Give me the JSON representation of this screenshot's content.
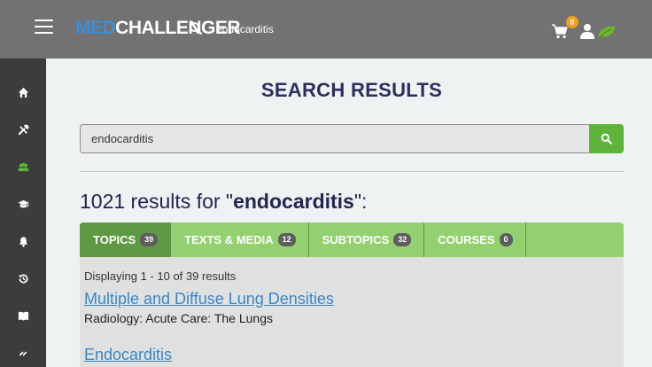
{
  "header": {
    "logo_med": "MED",
    "logo_challenger": "CHALLENGER",
    "search_query": "endocarditis",
    "cart_count": "0"
  },
  "sidebar": {
    "items": [
      {
        "icon": "home-icon"
      },
      {
        "icon": "tools-icon"
      },
      {
        "icon": "users-icon",
        "active": true
      },
      {
        "icon": "graduation-cap-icon"
      },
      {
        "icon": "bell-icon"
      },
      {
        "icon": "history-icon"
      },
      {
        "icon": "book-icon"
      },
      {
        "icon": "more-icon"
      }
    ]
  },
  "main": {
    "title": "SEARCH RESULTS",
    "search_value": "endocarditis",
    "results_count": "1021",
    "results_mid": " results for \"",
    "results_query": "endocarditis",
    "results_end": "\":",
    "tabs": [
      {
        "label": "TOPICS",
        "count": "39",
        "active": true
      },
      {
        "label": "TEXTS & MEDIA",
        "count": "12"
      },
      {
        "label": "SUBTOPICS",
        "count": "32"
      },
      {
        "label": "COURSES",
        "count": "0"
      }
    ],
    "displaying": "Displaying 1 - 10 of 39 results",
    "results": [
      {
        "title": "Multiple and Diffuse Lung Densities",
        "subtitle": "Radiology: Acute Care: The Lungs"
      },
      {
        "title": "Endocarditis",
        "subtitle": ""
      }
    ]
  },
  "colors": {
    "topbar": "#727272",
    "sidebar": "#3c3c3c",
    "accent_green": "#5eb33a",
    "tab_green": "#93d170",
    "link_blue": "#3a86c8",
    "title_navy": "#2b2f5c",
    "badge_orange": "#f0a020"
  }
}
